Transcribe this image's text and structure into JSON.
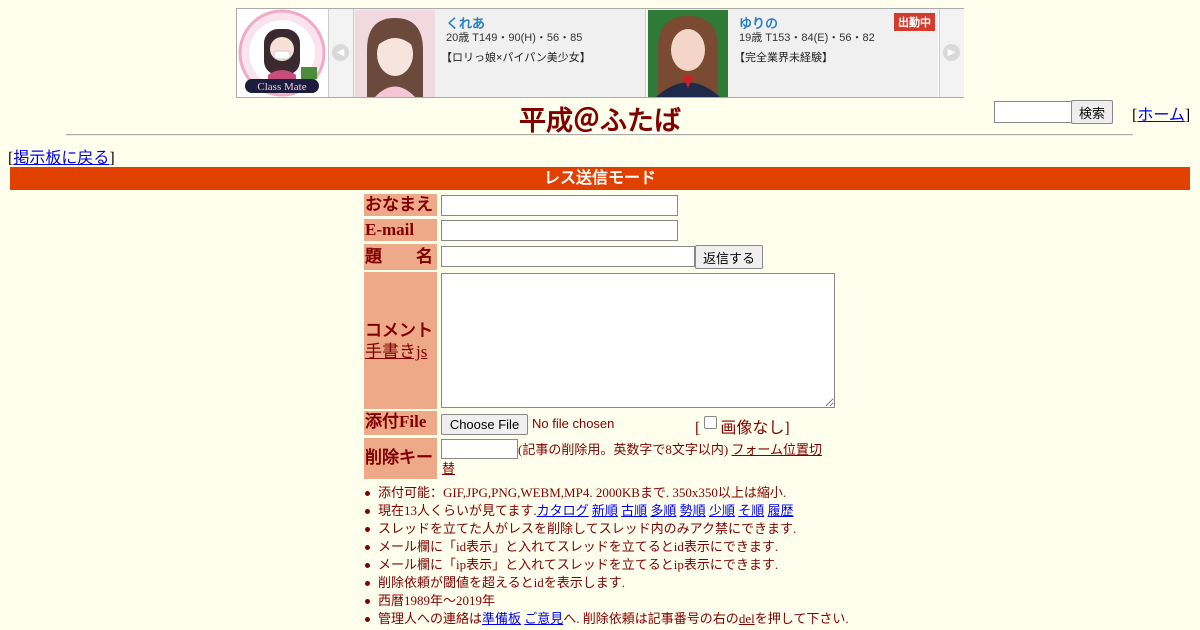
{
  "ad": {
    "logo_text": "Class Mate",
    "cards": [
      {
        "name": "くれあ",
        "specs": "20歳 T149・90(H)・56・85",
        "desc": "【ロリっ娘×パイパン美少女】"
      },
      {
        "name": "ゆりの",
        "specs": "19歳 T153・84(E)・56・82",
        "desc": "【完全業界未経験】",
        "badge": "出勤中"
      }
    ]
  },
  "header": {
    "title": "平成＠ふたば",
    "search_button": "検索",
    "home_link": "ホーム"
  },
  "nav": {
    "back_link": "掲示板に戻る"
  },
  "form": {
    "mode_title": "レス送信モード",
    "labels": {
      "name": "おなまえ",
      "email": "E-mail",
      "subject": "題　　名",
      "comment": "コメント",
      "handwrite": "手書きjs",
      "file": "添付File",
      "delkey": "削除キー"
    },
    "submit_button": "返信する",
    "choose_file_button": "Choose File",
    "file_status": "No file chosen",
    "no_image_label": "画像なし",
    "delkey_note": "(記事の削除用。英数字で8文字以内)",
    "form_position_link": "フォーム位置切替"
  },
  "rules": {
    "r1": "添付可能：GIF,JPG,PNG,WEBM,MP4. 2000KBまで. 350x350以上は縮小.",
    "r2_prefix": "現在13人くらいが見てます.",
    "r2_links": [
      "カタログ",
      "新順",
      "古順",
      "多順",
      "勢順",
      "少順",
      "そ順",
      "履歴"
    ],
    "r3": "スレッドを立てた人がレスを削除してスレッド内のみアク禁にできます.",
    "r4": "メール欄に「id表示」と入れてスレッドを立てるとid表示にできます.",
    "r5": "メール欄に「ip表示」と入れてスレッドを立てるとip表示にできます.",
    "r6": "削除依頼が閾値を超えるとidを表示します.",
    "r7": "西暦1989年～2019年",
    "r8_prefix": "管理人への連絡は",
    "r8_link1": "準備板",
    "r8_link2": "ご意見",
    "r8_mid": "へ. 削除依頼は記事番号の右の",
    "r8_del": "del",
    "r8_suffix": "を押して下さい."
  }
}
